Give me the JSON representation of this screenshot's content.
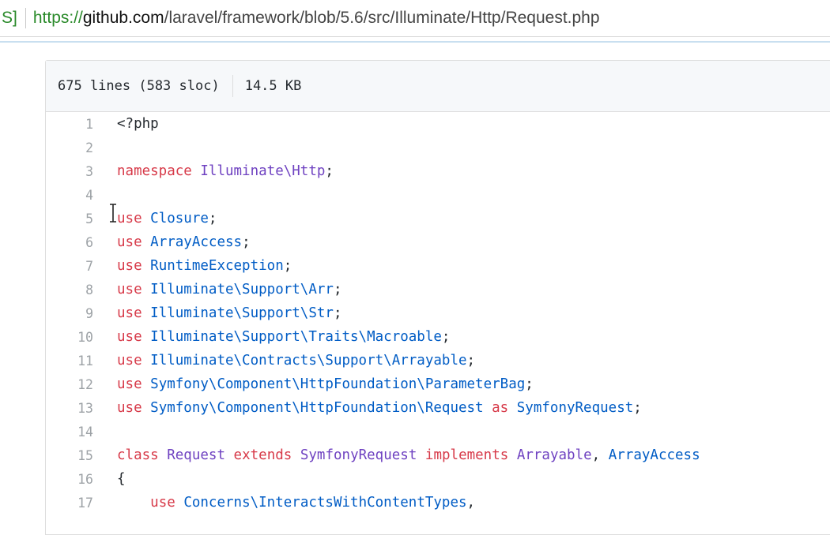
{
  "address_bar": {
    "prefix": "S]",
    "url_scheme": "https://",
    "url_host": "github.com",
    "url_path": "/laravel/framework/blob/5.6/src/Illuminate/Http/Request.php"
  },
  "file_header": {
    "lines_info": "675 lines (583 sloc)",
    "size": "14.5 KB"
  },
  "colors": {
    "keyword": "#d73a49",
    "entity": "#6f42c1",
    "class_name": "#005cc5",
    "url_green": "#2a8a2a"
  },
  "code_lines": [
    {
      "n": "1",
      "tokens": [
        [
          "plain",
          "<?php"
        ]
      ]
    },
    {
      "n": "2",
      "tokens": []
    },
    {
      "n": "3",
      "tokens": [
        [
          "kw",
          "namespace"
        ],
        [
          "plain",
          " "
        ],
        [
          "ent",
          "Illuminate\\Http"
        ],
        [
          "plain",
          ";"
        ]
      ]
    },
    {
      "n": "4",
      "tokens": []
    },
    {
      "n": "5",
      "tokens": [
        [
          "kw",
          "use"
        ],
        [
          "plain",
          " "
        ],
        [
          "cls",
          "Closure"
        ],
        [
          "plain",
          ";"
        ]
      ]
    },
    {
      "n": "6",
      "tokens": [
        [
          "kw",
          "use"
        ],
        [
          "plain",
          " "
        ],
        [
          "cls",
          "ArrayAccess"
        ],
        [
          "plain",
          ";"
        ]
      ]
    },
    {
      "n": "7",
      "tokens": [
        [
          "kw",
          "use"
        ],
        [
          "plain",
          " "
        ],
        [
          "cls",
          "RuntimeException"
        ],
        [
          "plain",
          ";"
        ]
      ]
    },
    {
      "n": "8",
      "tokens": [
        [
          "kw",
          "use"
        ],
        [
          "plain",
          " "
        ],
        [
          "cls",
          "Illuminate\\Support\\Arr"
        ],
        [
          "plain",
          ";"
        ]
      ]
    },
    {
      "n": "9",
      "tokens": [
        [
          "kw",
          "use"
        ],
        [
          "plain",
          " "
        ],
        [
          "cls",
          "Illuminate\\Support\\Str"
        ],
        [
          "plain",
          ";"
        ]
      ]
    },
    {
      "n": "10",
      "tokens": [
        [
          "kw",
          "use"
        ],
        [
          "plain",
          " "
        ],
        [
          "cls",
          "Illuminate\\Support\\Traits\\Macroable"
        ],
        [
          "plain",
          ";"
        ]
      ]
    },
    {
      "n": "11",
      "tokens": [
        [
          "kw",
          "use"
        ],
        [
          "plain",
          " "
        ],
        [
          "cls",
          "Illuminate\\Contracts\\Support\\Arrayable"
        ],
        [
          "plain",
          ";"
        ]
      ]
    },
    {
      "n": "12",
      "tokens": [
        [
          "kw",
          "use"
        ],
        [
          "plain",
          " "
        ],
        [
          "cls",
          "Symfony\\Component\\HttpFoundation\\ParameterBag"
        ],
        [
          "plain",
          ";"
        ]
      ]
    },
    {
      "n": "13",
      "tokens": [
        [
          "kw",
          "use"
        ],
        [
          "plain",
          " "
        ],
        [
          "cls",
          "Symfony\\Component\\HttpFoundation\\Request"
        ],
        [
          "plain",
          " "
        ],
        [
          "kw",
          "as"
        ],
        [
          "plain",
          " "
        ],
        [
          "cls",
          "SymfonyRequest"
        ],
        [
          "plain",
          ";"
        ]
      ]
    },
    {
      "n": "14",
      "tokens": []
    },
    {
      "n": "15",
      "tokens": [
        [
          "kw",
          "class"
        ],
        [
          "plain",
          " "
        ],
        [
          "ent",
          "Request"
        ],
        [
          "plain",
          " "
        ],
        [
          "kw",
          "extends"
        ],
        [
          "plain",
          " "
        ],
        [
          "ent",
          "SymfonyRequest"
        ],
        [
          "plain",
          " "
        ],
        [
          "kw",
          "implements"
        ],
        [
          "plain",
          " "
        ],
        [
          "ent",
          "Arrayable"
        ],
        [
          "plain",
          ", "
        ],
        [
          "cls",
          "ArrayAccess"
        ]
      ]
    },
    {
      "n": "16",
      "tokens": [
        [
          "plain",
          "{"
        ]
      ]
    },
    {
      "n": "17",
      "tokens": [
        [
          "plain",
          "    "
        ],
        [
          "kw",
          "use"
        ],
        [
          "plain",
          " "
        ],
        [
          "cls",
          "Concerns\\InteractsWithContentTypes"
        ],
        [
          "plain",
          ","
        ]
      ]
    }
  ]
}
